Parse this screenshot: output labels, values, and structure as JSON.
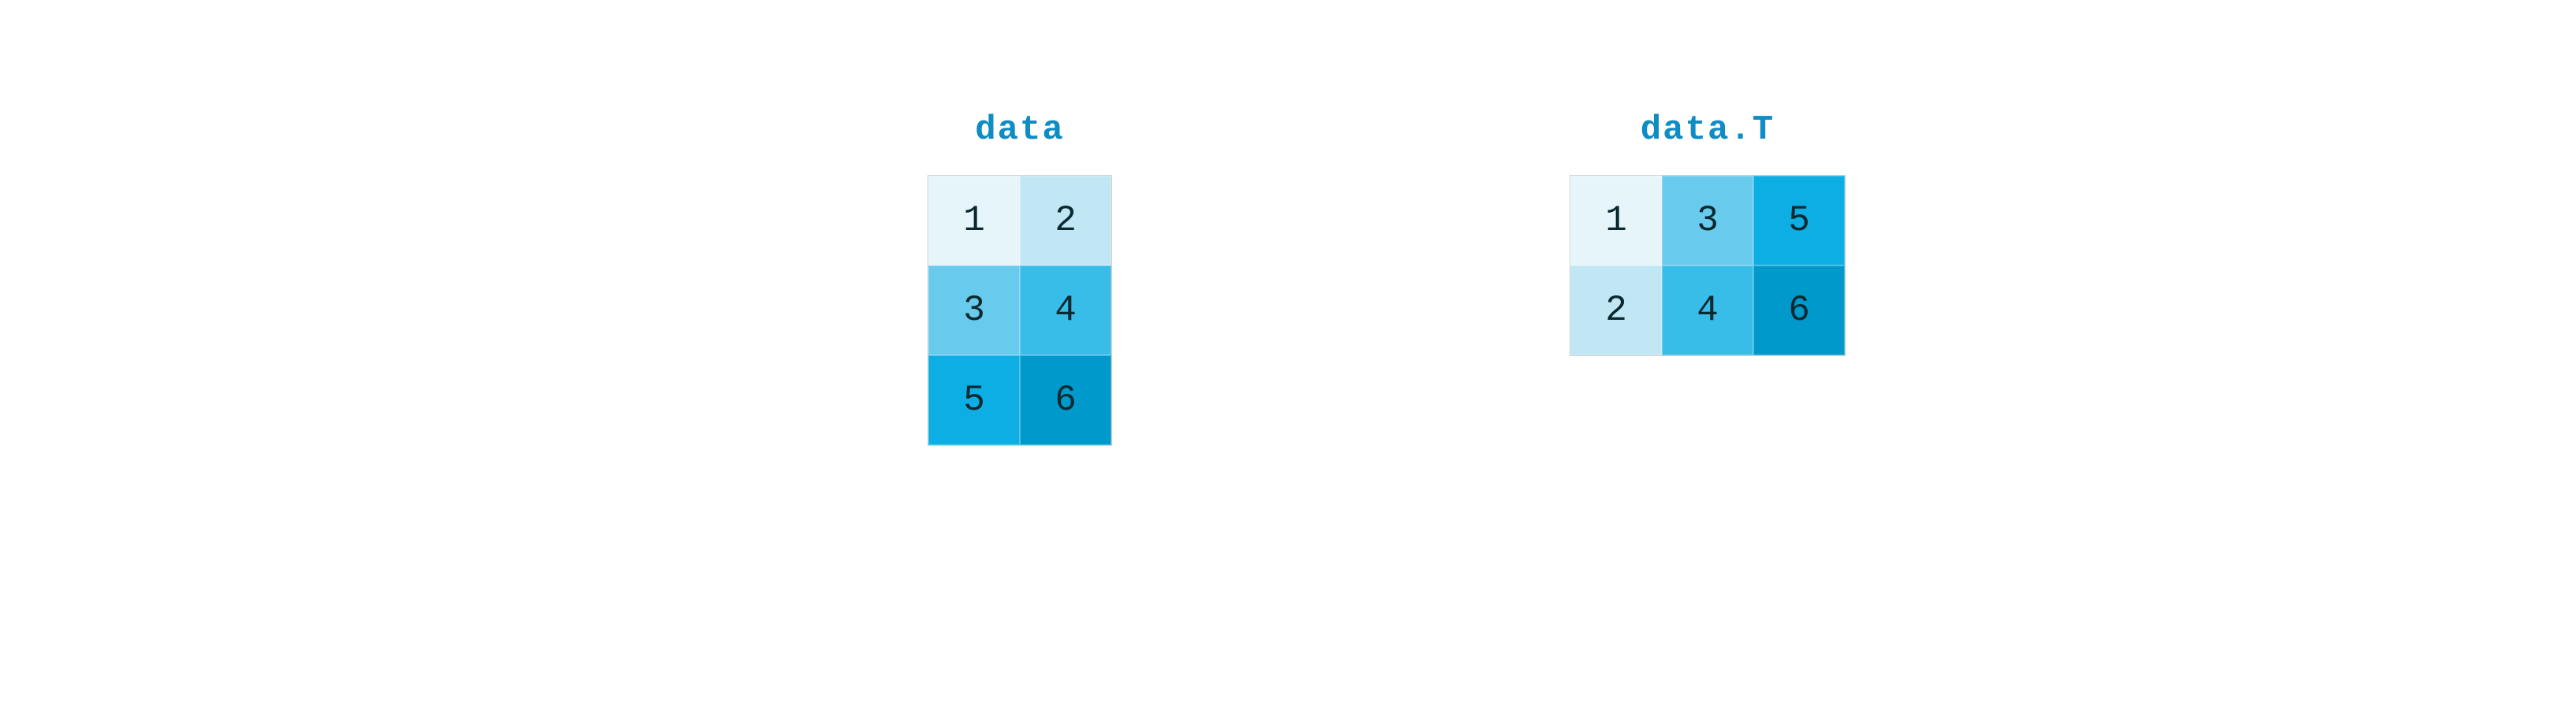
{
  "chart_data": [
    {
      "type": "table",
      "title": "data",
      "rows": [
        [
          1,
          2
        ],
        [
          3,
          4
        ],
        [
          5,
          6
        ]
      ]
    },
    {
      "type": "table",
      "title": "data.T",
      "rows": [
        [
          1,
          3,
          5
        ],
        [
          2,
          4,
          6
        ]
      ]
    }
  ],
  "left": {
    "title": "data",
    "cells": {
      "r0c0": "1",
      "r0c1": "2",
      "r1c0": "3",
      "r1c1": "4",
      "r2c0": "5",
      "r2c1": "6"
    }
  },
  "right": {
    "title": "data.T",
    "cells": {
      "r0c0": "1",
      "r0c1": "3",
      "r0c2": "5",
      "r1c0": "2",
      "r1c1": "4",
      "r1c2": "6"
    }
  },
  "colors": {
    "c1": "#e5f5fa",
    "c2": "#c1e7f4",
    "c3": "#68cbee",
    "c4": "#38bce8",
    "c5": "#0daee3",
    "c6": "#0099cc",
    "title": "#0e8cc3"
  }
}
